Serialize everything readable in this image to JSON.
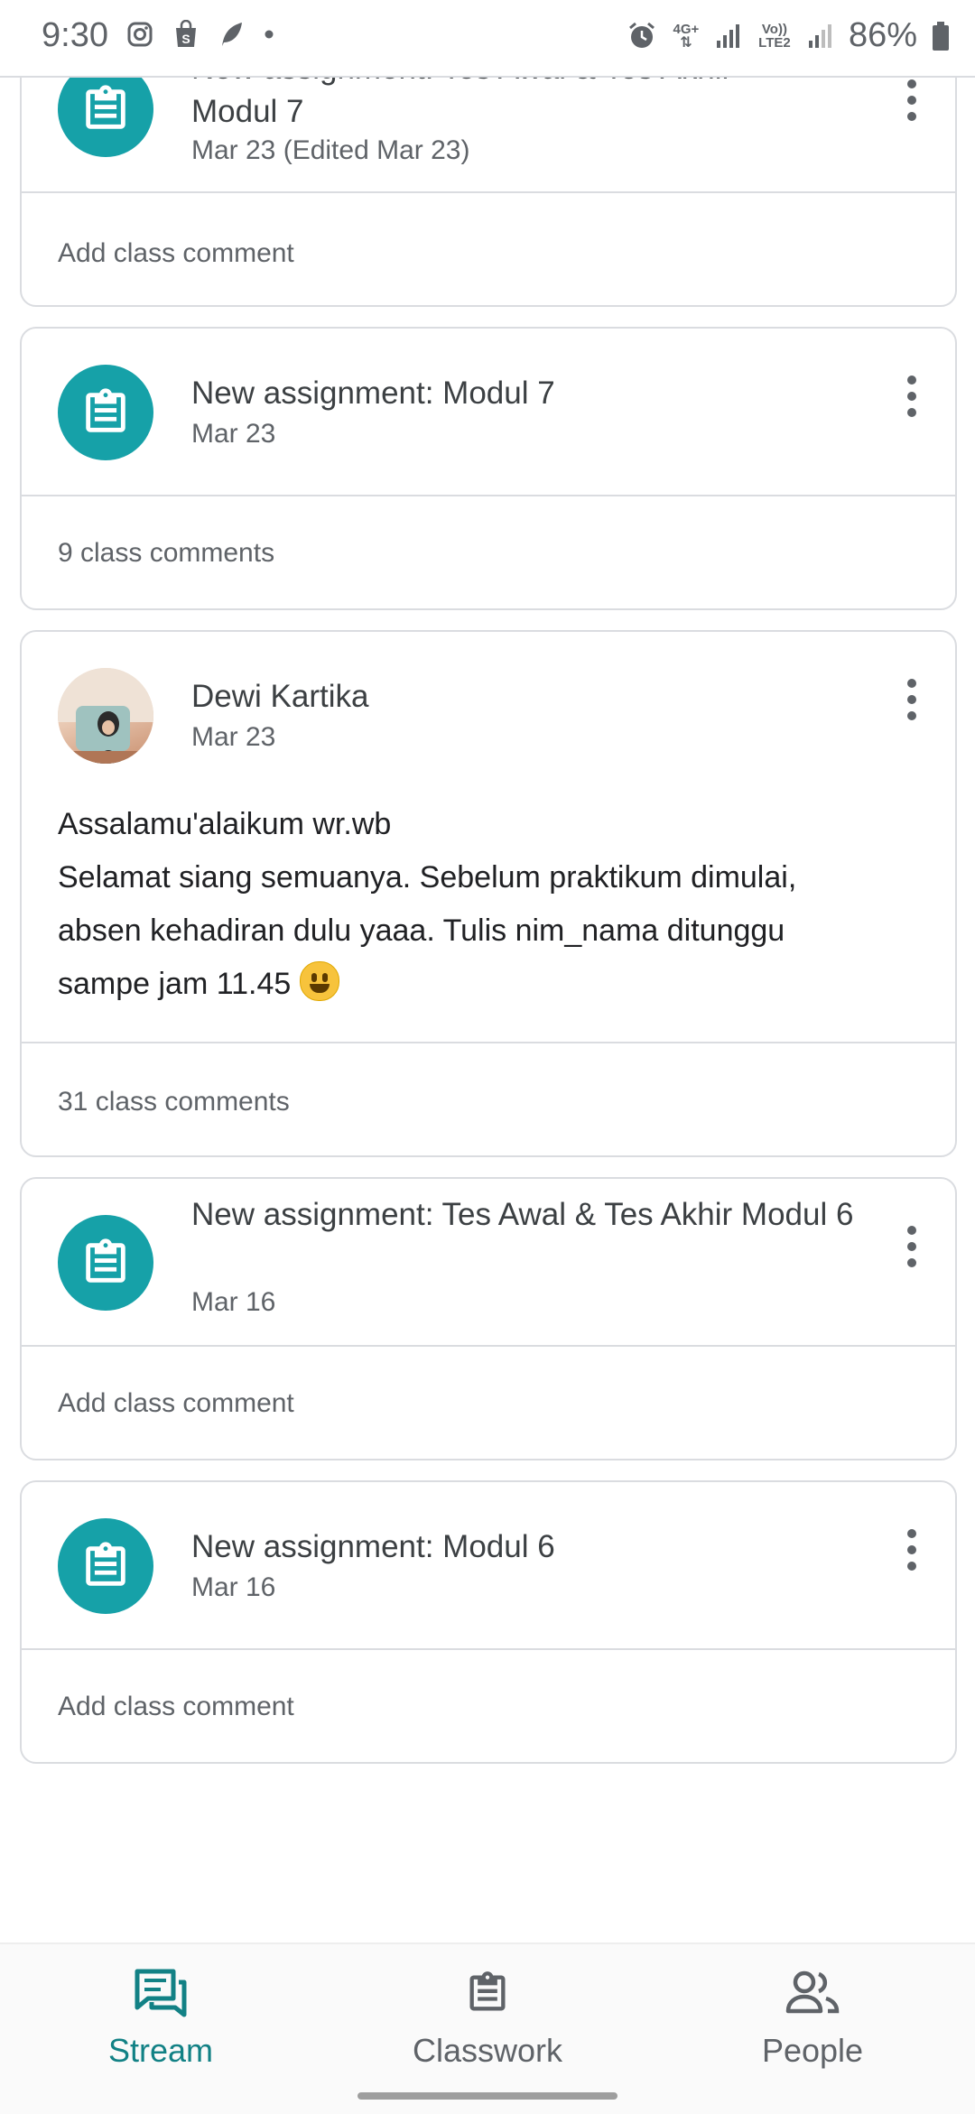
{
  "status_bar": {
    "time": "9:30",
    "battery": "86%",
    "network_top": "4G+",
    "network_volte": "Vo))",
    "network_lte": "LTE2"
  },
  "colors": {
    "assignment_teal": "#16a1a8",
    "active_nav": "#128185",
    "divider": "#dadce0"
  },
  "feed": [
    {
      "type": "assignment",
      "title_partial": "New assignment: Tes Awal & Tes Akhir",
      "title_line2": "Modul 7",
      "date": "Mar 23 (Edited Mar 23)",
      "comment_label": "Add class comment",
      "icon": "assignment-icon"
    },
    {
      "type": "assignment",
      "title": "New assignment: Modul 7",
      "date": "Mar 23",
      "comment_label": "9 class comments",
      "icon": "assignment-icon"
    },
    {
      "type": "post",
      "author": "Dewi Kartika",
      "date": "Mar 23",
      "body_line1": "Assalamu'alaikum wr.wb",
      "body_line2": "Selamat siang semuanya. Sebelum praktikum dimulai,",
      "body_line3": "absen kehadiran dulu yaaa. Tulis nim_nama ditunggu",
      "body_line4": "sampe jam 11.45",
      "comment_label": "31 class comments"
    },
    {
      "type": "assignment",
      "title": "New assignment: Tes Awal & Tes Akhir Modul 6",
      "date": "Mar 16",
      "comment_label": "Add class comment",
      "icon": "assignment-icon"
    },
    {
      "type": "assignment",
      "title": "New assignment: Modul 6",
      "date": "Mar 16",
      "comment_label": "Add class comment",
      "icon": "assignment-icon"
    }
  ],
  "bottom_nav": [
    {
      "label": "Stream",
      "icon": "stream-icon",
      "active": true
    },
    {
      "label": "Classwork",
      "icon": "classwork-icon",
      "active": false
    },
    {
      "label": "People",
      "icon": "people-icon",
      "active": false
    }
  ]
}
